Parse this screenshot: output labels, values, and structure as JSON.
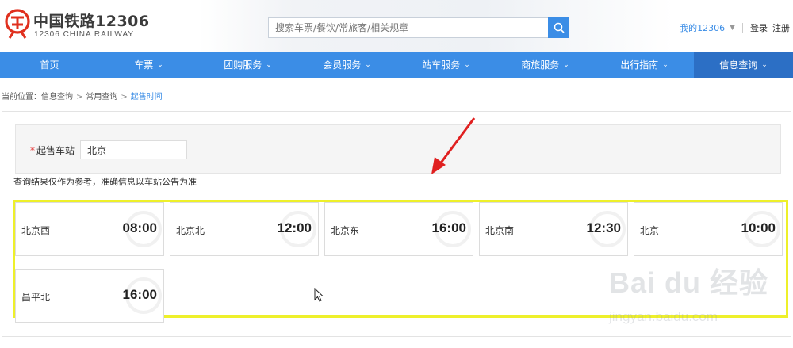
{
  "header": {
    "logo_cn": "中国铁路12306",
    "logo_en": "12306 CHINA RAILWAY",
    "search_placeholder": "搜索车票/餐饮/常旅客/相关规章",
    "my_account": "我的12306",
    "login": "登录",
    "register": "注册"
  },
  "nav": {
    "items": [
      {
        "label": "首页",
        "has_caret": false
      },
      {
        "label": "车票",
        "has_caret": true
      },
      {
        "label": "团购服务",
        "has_caret": true
      },
      {
        "label": "会员服务",
        "has_caret": true
      },
      {
        "label": "站车服务",
        "has_caret": true
      },
      {
        "label": "商旅服务",
        "has_caret": true
      },
      {
        "label": "出行指南",
        "has_caret": true
      },
      {
        "label": "信息查询",
        "has_caret": true,
        "active": true
      }
    ]
  },
  "breadcrumb": {
    "prefix": "当前位置：",
    "items": [
      "信息查询",
      "常用查询"
    ],
    "current": "起售时间",
    "separator": ">"
  },
  "form": {
    "station_label": "起售车站",
    "station_value": "北京",
    "notice": "查询结果仅作为参考，准确信息以车站公告为准"
  },
  "results": [
    {
      "station": "北京西",
      "time": "08:00"
    },
    {
      "station": "北京北",
      "time": "12:00"
    },
    {
      "station": "北京东",
      "time": "16:00"
    },
    {
      "station": "北京南",
      "time": "12:30"
    },
    {
      "station": "北京",
      "time": "10:00"
    },
    {
      "station": "昌平北",
      "time": "16:00"
    }
  ],
  "watermark": {
    "text": "Bai du 经验",
    "url": "jingyan.baidu.com"
  },
  "colors": {
    "brand_blue": "#3b8de6",
    "nav_active": "#2c6fc5",
    "highlight_yellow": "#eef02a",
    "logo_red": "#e0301e",
    "annotation_red": "#e02020"
  }
}
